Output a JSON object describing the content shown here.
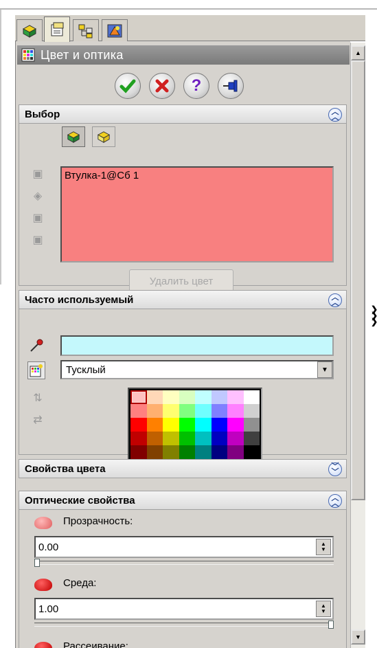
{
  "title": "Цвет и оптика",
  "sections": {
    "selection": {
      "title": "Выбор",
      "selected_item": "Втулка-1@Сб 1",
      "remove_color_label": "Удалить цвет"
    },
    "frequent": {
      "title": "Часто используемый",
      "appearance_value": "Тусклый"
    },
    "color_props": {
      "title": "Свойства цвета"
    },
    "optical": {
      "title": "Оптические свойства",
      "transparency_label": "Прозрачность:",
      "transparency_value": "0.00",
      "transparency_level": 0.0,
      "ambient_label": "Среда:",
      "ambient_value": "1.00",
      "ambient_level": 1.0,
      "diffuse_label": "Рассеивание:"
    }
  },
  "palette": [
    "#ffc0c0",
    "#ffd8b8",
    "#ffffc0",
    "#d8ffc0",
    "#c0ffff",
    "#c0c8ff",
    "#ffc0ff",
    "#ffffff",
    "#ff8080",
    "#ffb070",
    "#ffff70",
    "#80ff80",
    "#70ffff",
    "#8080ff",
    "#ff80ff",
    "#d0d0d0",
    "#ff0000",
    "#ff8000",
    "#ffff00",
    "#00ff00",
    "#00ffff",
    "#0000ff",
    "#ff00ff",
    "#909090",
    "#c00000",
    "#c06000",
    "#c0c000",
    "#00c000",
    "#00c0c0",
    "#0000c0",
    "#c000c0",
    "#404040",
    "#800000",
    "#804000",
    "#808000",
    "#008000",
    "#008080",
    "#000080",
    "#800080",
    "#000000"
  ],
  "colors": {
    "selection_box": "#f88080",
    "color_field": "#c4f8fc",
    "panel_bg": "#d6d3ce",
    "title_bar": "#8a8a8a"
  },
  "icons": {
    "ok": "check-icon",
    "cancel": "x-icon",
    "help": "question-icon",
    "pin": "pushpin-icon"
  }
}
